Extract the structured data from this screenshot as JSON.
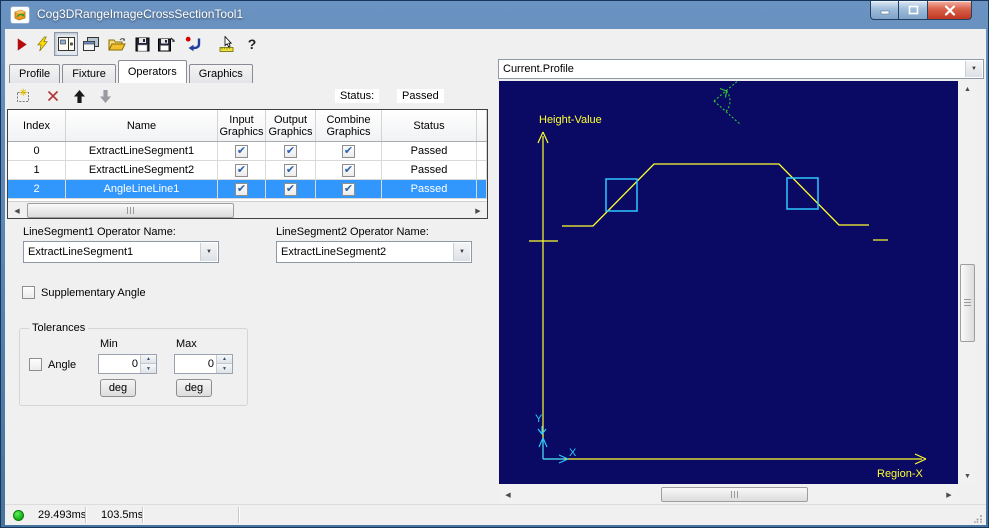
{
  "titlebar": {
    "title": "Cog3DRangeImageCrossSectionTool1"
  },
  "tabs": {
    "items": [
      {
        "label": "Profile",
        "active": false
      },
      {
        "label": "Fixture",
        "active": false
      },
      {
        "label": "Operators",
        "active": true
      },
      {
        "label": "Graphics",
        "active": false
      }
    ]
  },
  "operators_tab": {
    "status_label": "Status:",
    "status_value": "Passed",
    "grid": {
      "columns": [
        "Index",
        "Name",
        "Input Graphics",
        "Output Graphics",
        "Combine Graphics",
        "Status"
      ],
      "rows": [
        {
          "index": "0",
          "name": "ExtractLineSegment1",
          "input_graphics": true,
          "output_graphics": true,
          "combine_graphics": true,
          "status": "Passed",
          "selected": false
        },
        {
          "index": "1",
          "name": "ExtractLineSegment2",
          "input_graphics": true,
          "output_graphics": true,
          "combine_graphics": true,
          "status": "Passed",
          "selected": false
        },
        {
          "index": "2",
          "name": "AngleLineLine1",
          "input_graphics": true,
          "output_graphics": true,
          "combine_graphics": true,
          "status": "Passed",
          "selected": true
        }
      ]
    },
    "line_segment1": {
      "label": "LineSegment1 Operator Name:",
      "value": "ExtractLineSegment1"
    },
    "line_segment2": {
      "label": "LineSegment2 Operator Name:",
      "value": "ExtractLineSegment2"
    },
    "supplementary_angle": {
      "label": "Supplementary Angle",
      "checked": false
    },
    "tolerances": {
      "title": "Tolerances",
      "min_label": "Min",
      "max_label": "Max",
      "angle": {
        "label": "Angle",
        "checked": false,
        "min": "0",
        "max": "0",
        "unit": "deg"
      }
    }
  },
  "display": {
    "record_selector": "Current.Profile",
    "canvas": {
      "background": "#0a0a64",
      "axis_label_y": "Height-Value",
      "axis_label_x": "Region-X",
      "marker_y_label": "Y",
      "marker_x_label": "X",
      "profile_color": "#ffff2e",
      "axis_color": "#ffff2e",
      "fit_box_color": "#2ec8ff",
      "angle_marker_color": "#2fcc2f",
      "profile_points": [
        [
          63,
          145
        ],
        [
          94,
          145
        ],
        [
          155,
          83
        ],
        [
          280,
          83
        ],
        [
          340,
          144
        ],
        [
          370,
          144
        ]
      ],
      "left_tick": [
        30,
        160,
        59,
        160
      ],
      "right_tick": [
        374,
        159,
        389,
        159
      ],
      "fit_boxes": [
        [
          107,
          98,
          31,
          32
        ],
        [
          288,
          97,
          31,
          31
        ]
      ]
    }
  },
  "status_bar": {
    "run_time": "29.493ms",
    "total_time": "103.5ms"
  }
}
